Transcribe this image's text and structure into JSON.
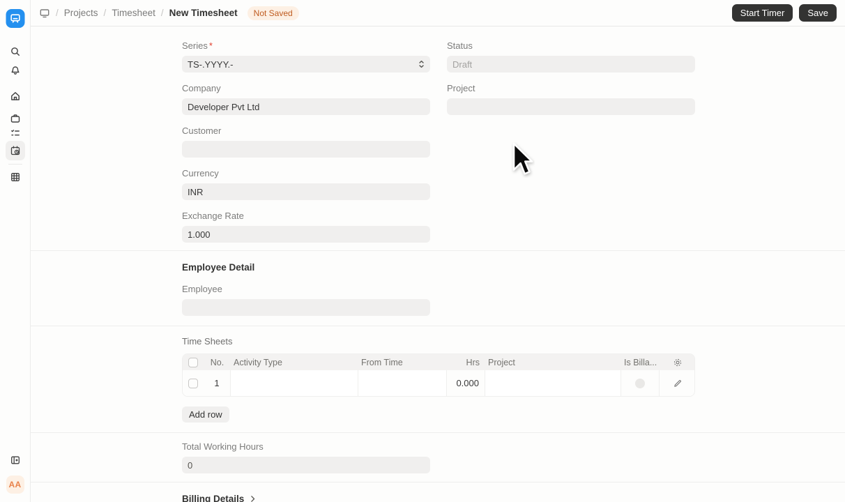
{
  "colors": {
    "accent_blue": "#2490ef",
    "badge_bg": "#fdf0e4",
    "badge_text": "#bf5b1f",
    "button_bg": "#333332",
    "field_bg": "#f0efee"
  },
  "topbar": {
    "breadcrumb": {
      "separator": "/",
      "items": [
        "Projects",
        "Timesheet"
      ],
      "current": "New Timesheet"
    },
    "status_badge": "Not Saved",
    "buttons": {
      "start_timer": "Start Timer",
      "save": "Save"
    }
  },
  "sidebar": {
    "icons": [
      "app-logo",
      "search",
      "notifications",
      "home",
      "briefcase",
      "task-list",
      "timesheet-calendar",
      "table",
      "collapse-panel"
    ],
    "active_icon": "timesheet-calendar",
    "avatar_initials": "AA"
  },
  "form": {
    "series": {
      "label": "Series",
      "required_marker": "*",
      "value": "TS-.YYYY.-"
    },
    "status": {
      "label": "Status",
      "value": "Draft"
    },
    "company": {
      "label": "Company",
      "value": "Developer Pvt Ltd"
    },
    "project": {
      "label": "Project",
      "value": ""
    },
    "customer": {
      "label": "Customer",
      "value": ""
    },
    "currency": {
      "label": "Currency",
      "value": "INR"
    },
    "exchange_rate": {
      "label": "Exchange Rate",
      "value": "1.000"
    },
    "employee_detail": {
      "heading": "Employee Detail",
      "employee": {
        "label": "Employee",
        "value": ""
      }
    },
    "time_sheets": {
      "heading": "Time Sheets",
      "table": {
        "headers": [
          "No.",
          "Activity Type",
          "From Time",
          "Hrs",
          "Project",
          "Is Billa..."
        ],
        "rows": [
          {
            "no": "1",
            "activity_type": "",
            "from_time": "",
            "hrs": "0.000",
            "project": ""
          }
        ]
      },
      "add_row_label": "Add row"
    },
    "total_working_hours": {
      "label": "Total Working Hours",
      "value": "0"
    },
    "billing_details": {
      "heading": "Billing Details"
    }
  }
}
